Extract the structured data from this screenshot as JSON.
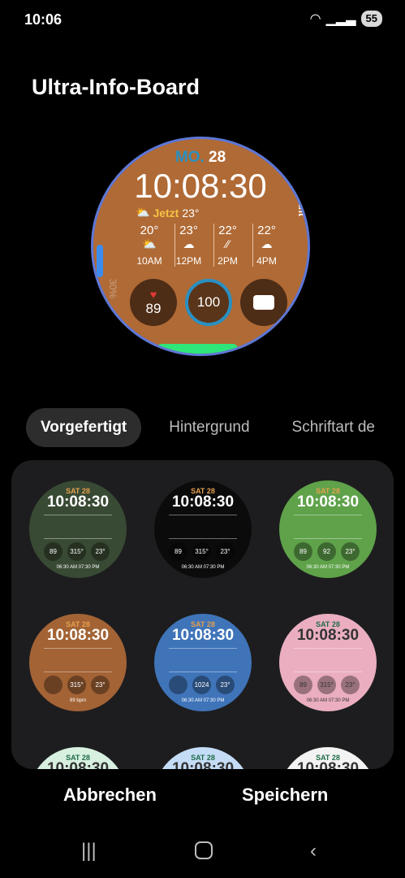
{
  "status_bar": {
    "time": "10:06",
    "battery": "55"
  },
  "title": "Ultra-Info-Board",
  "main_face": {
    "day": "MO.",
    "date": "28",
    "time": "10:08:30",
    "now_label": "Jetzt",
    "now_temp": "23°",
    "forecast": [
      {
        "temp": "20°",
        "time": "10AM"
      },
      {
        "temp": "23°",
        "time": "12PM"
      },
      {
        "temp": "22°",
        "time": "2PM"
      },
      {
        "temp": "22°",
        "time": "4PM"
      }
    ],
    "heart": "89",
    "steps": "100",
    "assistant": "Assistant",
    "percent": "30%"
  },
  "tabs": [
    "Vorgefertigt",
    "Hintergrund",
    "Schriftart de"
  ],
  "tiles": [
    {
      "date": "SAT 28",
      "time": "10:08:30",
      "bg": "#394a34",
      "b1": "89",
      "b2": "315°",
      "b3": "23°",
      "foot": "06:30 AM  07:30 PM"
    },
    {
      "date": "SAT 28",
      "time": "10:08:30",
      "bg": "#0b0b0b",
      "b1": "89",
      "b2": "315°",
      "b3": "23°",
      "foot": "06:30 AM  07:30 PM"
    },
    {
      "date": "SAT 28",
      "time": "10:08:30",
      "bg": "#5fa24a",
      "b1": "89",
      "b2": "92",
      "b3": "23°",
      "foot": "06:30 AM  07:30 PM"
    },
    {
      "date": "SAT 28",
      "time": "10:08:30",
      "bg": "#a36335",
      "b1": "",
      "b2": "315°",
      "b3": "23°",
      "foot": "89 bpm"
    },
    {
      "date": "SAT 28",
      "time": "10:08:30",
      "bg": "#3f74b9",
      "b1": "",
      "b2": "1024",
      "b3": "23°",
      "foot": "06:30 AM  07:30 PM"
    },
    {
      "date": "SAT 28",
      "time": "10:08:30",
      "bg": "#eaaec0",
      "b1": "89",
      "b2": "315°",
      "b3": "23°",
      "foot": "06:30 AM  07:30 PM"
    },
    {
      "date": "SAT 28",
      "time": "10:08:30",
      "bg": "#d7f0df",
      "b1": "",
      "b2": "",
      "b3": "",
      "foot": ""
    },
    {
      "date": "SAT 28",
      "time": "10:08:30",
      "bg": "#c4dcf6",
      "b1": "",
      "b2": "",
      "b3": "",
      "foot": ""
    },
    {
      "date": "SAT 28",
      "time": "10:08:30",
      "bg": "#f3f3f3",
      "b1": "",
      "b2": "",
      "b3": "",
      "foot": ""
    }
  ],
  "buttons": {
    "cancel": "Abbrechen",
    "save": "Speichern"
  }
}
